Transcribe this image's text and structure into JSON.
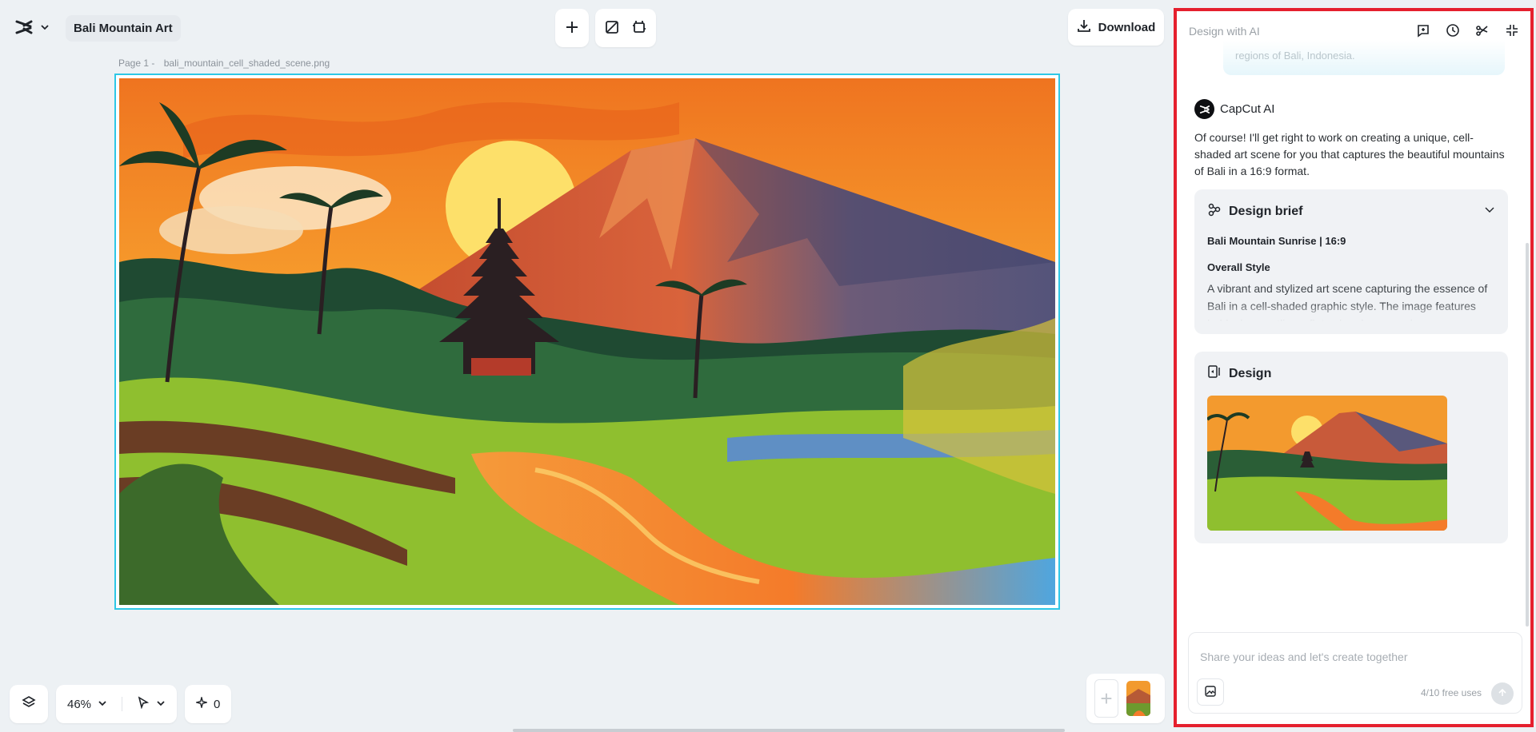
{
  "app": {
    "project_title": "Bali Mountain Art"
  },
  "page": {
    "label": "Page 1 -",
    "file_name": "bali_mountain_cell_shaded_scene.png"
  },
  "toolbar": {
    "download_label": "Download"
  },
  "bottom_bar": {
    "zoom": "46%",
    "ai_credits": "0"
  },
  "panel": {
    "title": "Design with AI",
    "user_message_tail": "regions of Bali, Indonesia.",
    "ai_name": "CapCut AI",
    "ai_message": "Of course! I'll get right to work on creating a unique, cell-shaded art scene for you that captures the beautiful mountains of Bali in a 16:9 format.",
    "brief": {
      "title": "Design brief",
      "subtitle": "Bali Mountain Sunrise | 16:9",
      "section": "Overall Style",
      "body": "A vibrant and stylized art scene capturing the essence of Bali in a cell-shaded graphic style. The image features bold, clean outlines, flat color planes, and"
    },
    "design": {
      "title": "Design"
    },
    "composer": {
      "placeholder": "Share your ideas and let's create together",
      "free_uses": "4/10 free uses"
    }
  },
  "colors": {
    "accent": "#2ec7e6",
    "highlight": "#e5202e"
  }
}
